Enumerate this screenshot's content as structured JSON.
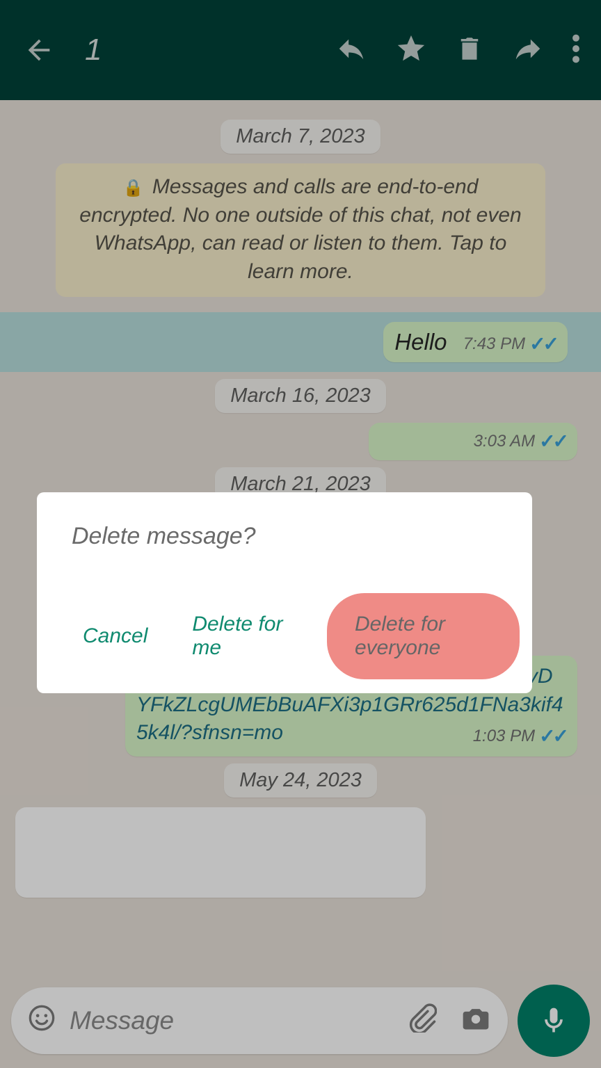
{
  "header": {
    "selected_count": "1"
  },
  "dates": {
    "d1": "March 7, 2023",
    "d2": "March 16, 2023",
    "d3": "March 21, 2023",
    "d4": "May 24, 2023"
  },
  "encryption_banner": "Messages and calls are end-to-end encrypted. No one outside of this chat, not even WhatsApp, can read or listen to them. Tap to learn more.",
  "messages": {
    "m1": {
      "text": "Hello",
      "time": "7:43 PM"
    },
    "m2": {
      "text": "",
      "time": "3:03 AM"
    },
    "m3": {
      "text": "/posts/pfbid0iPSzcZf85wnmT7hQHDpsiZ8vDYFkZLcgUMEbBuAFXi3p1GRr625d1FNa3kif45k4l/?sfnsn=mo",
      "time": "1:03 PM"
    }
  },
  "input": {
    "placeholder": "Message"
  },
  "dialog": {
    "title": "Delete message?",
    "cancel": "Cancel",
    "delete_me": "Delete for me",
    "delete_all": "Delete for everyone"
  }
}
